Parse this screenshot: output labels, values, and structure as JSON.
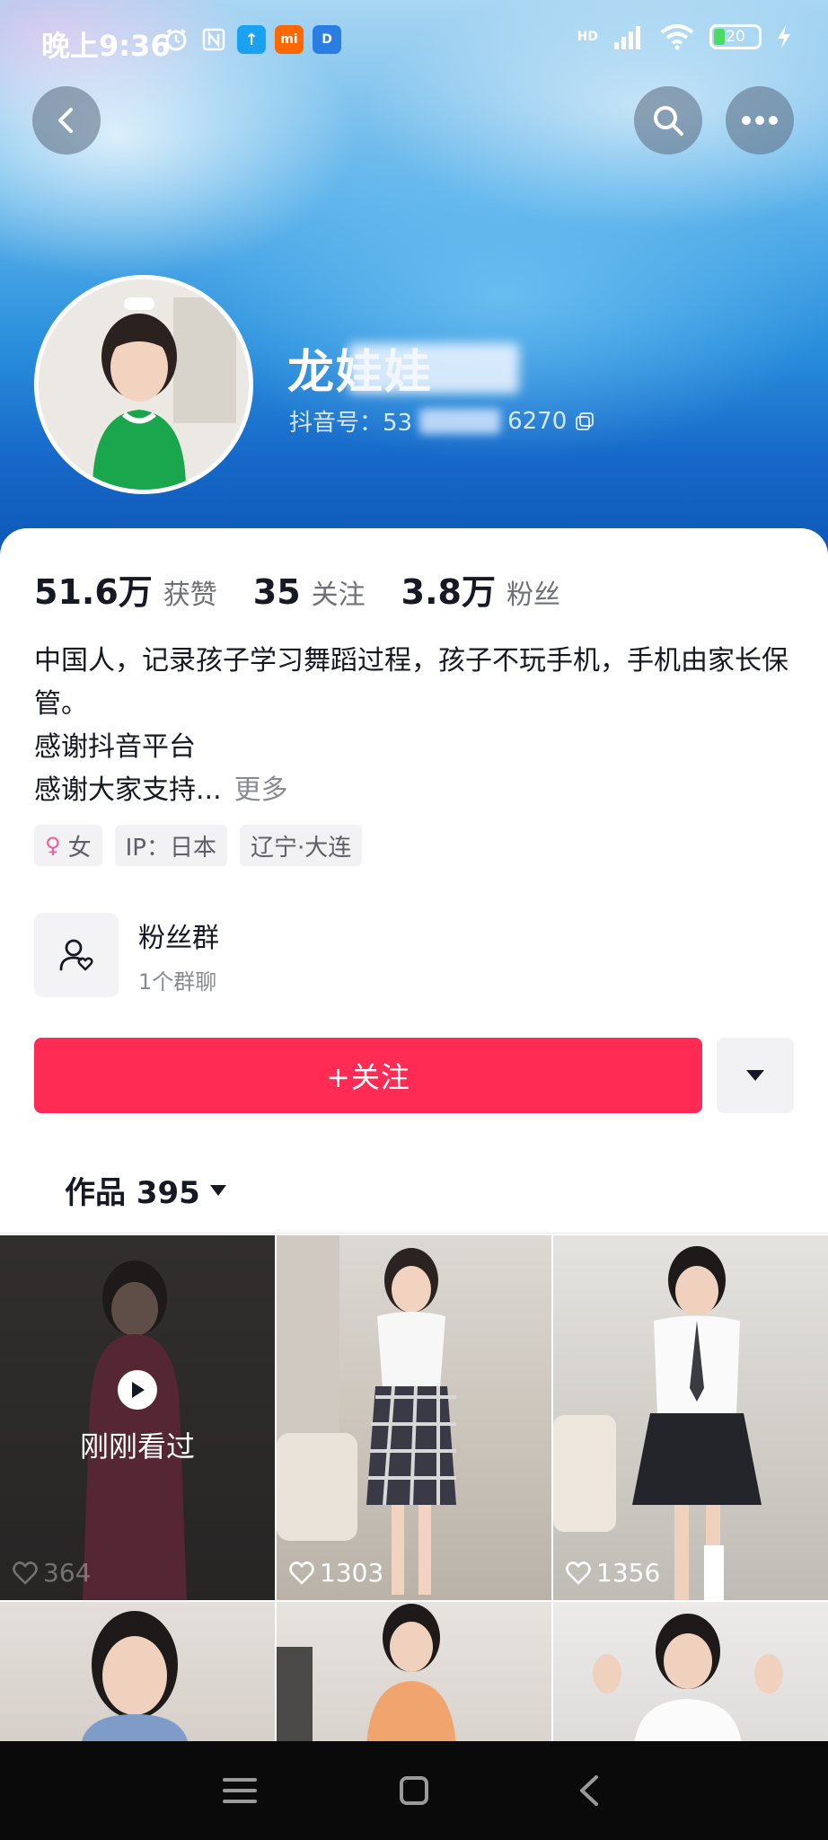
{
  "status_bar": {
    "time": "晚上9:36",
    "battery": "20",
    "network": "HD"
  },
  "profile": {
    "username": "龙娃娃",
    "douyin_id": "抖音号：53",
    "douyin_id_suffix": "6270"
  },
  "stats": [
    {
      "value": "51.6万",
      "label": "获赞"
    },
    {
      "value": "35",
      "label": "关注"
    },
    {
      "value": "3.8万",
      "label": "粉丝"
    }
  ],
  "bio": {
    "line1": "中国人，记录孩子学习舞蹈过程，孩子不玩手机，手机由家长保管。",
    "line2": "感谢抖音平台",
    "line3": "感谢大家支持...",
    "more": "更多"
  },
  "tags": {
    "gender": "女",
    "ip": "IP：日本",
    "location": "辽宁·大连"
  },
  "fans_group": {
    "title": "粉丝群",
    "subtitle": "1个群聊"
  },
  "actions": {
    "follow": "+关注"
  },
  "works": {
    "label": "作品 395"
  },
  "videos": [
    {
      "likes": "364",
      "watched_label": "刚刚看过"
    },
    {
      "likes": "1303"
    },
    {
      "likes": "1356"
    },
    {
      "likes": ""
    },
    {
      "likes": ""
    },
    {
      "likes": ""
    }
  ],
  "colors": {
    "accent": "#fe2c55",
    "banner_blue": "#1668c8"
  }
}
